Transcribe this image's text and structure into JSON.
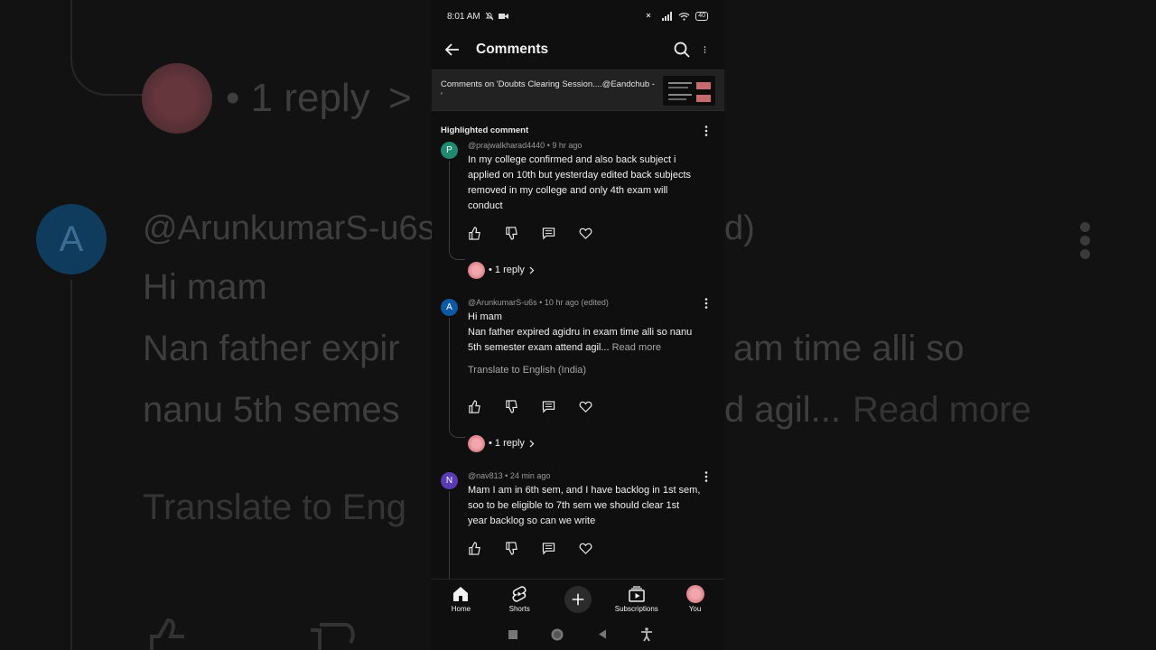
{
  "background": {
    "reply_text": "• 1 reply",
    "author_text": "@ArunkumarS-u6s",
    "author_suffix": "d)",
    "line1": "Hi mam",
    "line2a": "Nan father expir",
    "line2b": "am  time  alli so",
    "line3a": "nanu 5th semes",
    "line3b": "d agil...",
    "read_more": "Read more",
    "translate": "Translate to Eng",
    "avatar_letter": "A"
  },
  "statusbar": {
    "time": "8:01 AM",
    "battery": "40"
  },
  "appbar": {
    "title": "Comments"
  },
  "video": {
    "caption": "Comments on 'Doubts Clearing Session....@Eandchub - '"
  },
  "highlighted_label": "Highlighted comment",
  "comments": [
    {
      "avatar_letter": "P",
      "avatar_color": "#1f8a70",
      "author": "@prajwalkharad4440",
      "time": "9 hr ago",
      "text": "In my college confirmed and also back subject i applied on 10th but yesterday edited  back subjects removed in my college and only 4th exam will conduct",
      "reply_label": "• 1 reply"
    },
    {
      "avatar_letter": "A",
      "avatar_color": "#0b5aa3",
      "author": "@ArunkumarS-u6s",
      "time": "10 hr ago (edited)",
      "line1": "Hi mam",
      "line2": "Nan father expired agidru in exam  time  alli so nanu 5th semester exam attend agil...",
      "read_more": "Read more",
      "translate": "Translate to English (India)",
      "reply_label": "• 1 reply"
    },
    {
      "avatar_letter": "N",
      "avatar_color": "#5b3bb5",
      "author": "@nav813",
      "time": "24 min ago",
      "text": "Mam I am in 6th sem, and I have backlog in 1st sem, soo to be eligible to 7th sem we should clear 1st year backlog so can we write"
    }
  ],
  "bottom_nav": [
    {
      "label": "Home",
      "icon": "home-icon"
    },
    {
      "label": "Shorts",
      "icon": "shorts-icon"
    },
    {
      "label": "",
      "icon": "create-icon"
    },
    {
      "label": "Subscriptions",
      "icon": "subscriptions-icon"
    },
    {
      "label": "You",
      "icon": "avatar"
    }
  ]
}
